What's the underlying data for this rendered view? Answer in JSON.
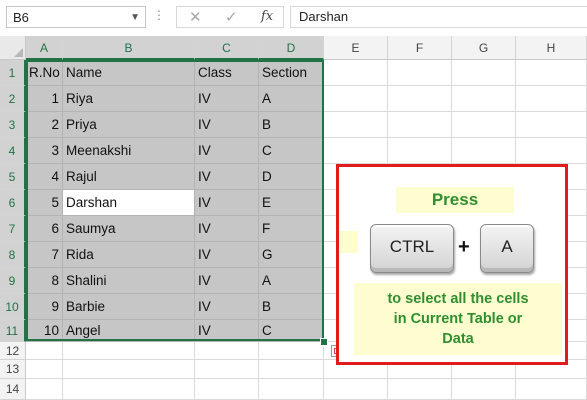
{
  "formula_bar": {
    "name_box": "B6",
    "fx_label": "fx",
    "cancel_icon": "x-icon",
    "enter_icon": "check-icon",
    "formula": "Darshan"
  },
  "columns": [
    "A",
    "B",
    "C",
    "D",
    "E",
    "F",
    "G",
    "H"
  ],
  "rows": [
    "1",
    "2",
    "3",
    "4",
    "5",
    "6",
    "7",
    "8",
    "9",
    "10",
    "11",
    "12",
    "13",
    "14"
  ],
  "table": {
    "header": [
      "R.No",
      "Name",
      "Class",
      "Section"
    ],
    "records": [
      [
        "1",
        "Riya",
        "IV",
        "A"
      ],
      [
        "2",
        "Priya",
        "IV",
        "B"
      ],
      [
        "3",
        "Meenakshi",
        "IV",
        "C"
      ],
      [
        "4",
        "Rajul",
        "IV",
        "D"
      ],
      [
        "5",
        "Darshan",
        "IV",
        "E"
      ],
      [
        "6",
        "Saumya",
        "IV",
        "F"
      ],
      [
        "7",
        "Rida",
        "IV",
        "G"
      ],
      [
        "8",
        "Shalini",
        "IV",
        "A"
      ],
      [
        "9",
        "Barbie",
        "IV",
        "B"
      ],
      [
        "10",
        "Angel",
        "IV",
        "C"
      ]
    ]
  },
  "active_cell": "B6",
  "annotation": {
    "press": "Press",
    "key1": "CTRL",
    "plus": "+",
    "key2": "A",
    "description": [
      "to select all the cells",
      "in Current Table or",
      "Data"
    ]
  },
  "colors": {
    "selection": "#217346",
    "highlight": "#c6c6c6",
    "callout_border": "#e21b1b",
    "note_text": "#2f8f2f",
    "note_bg": "#fdfdd0"
  }
}
